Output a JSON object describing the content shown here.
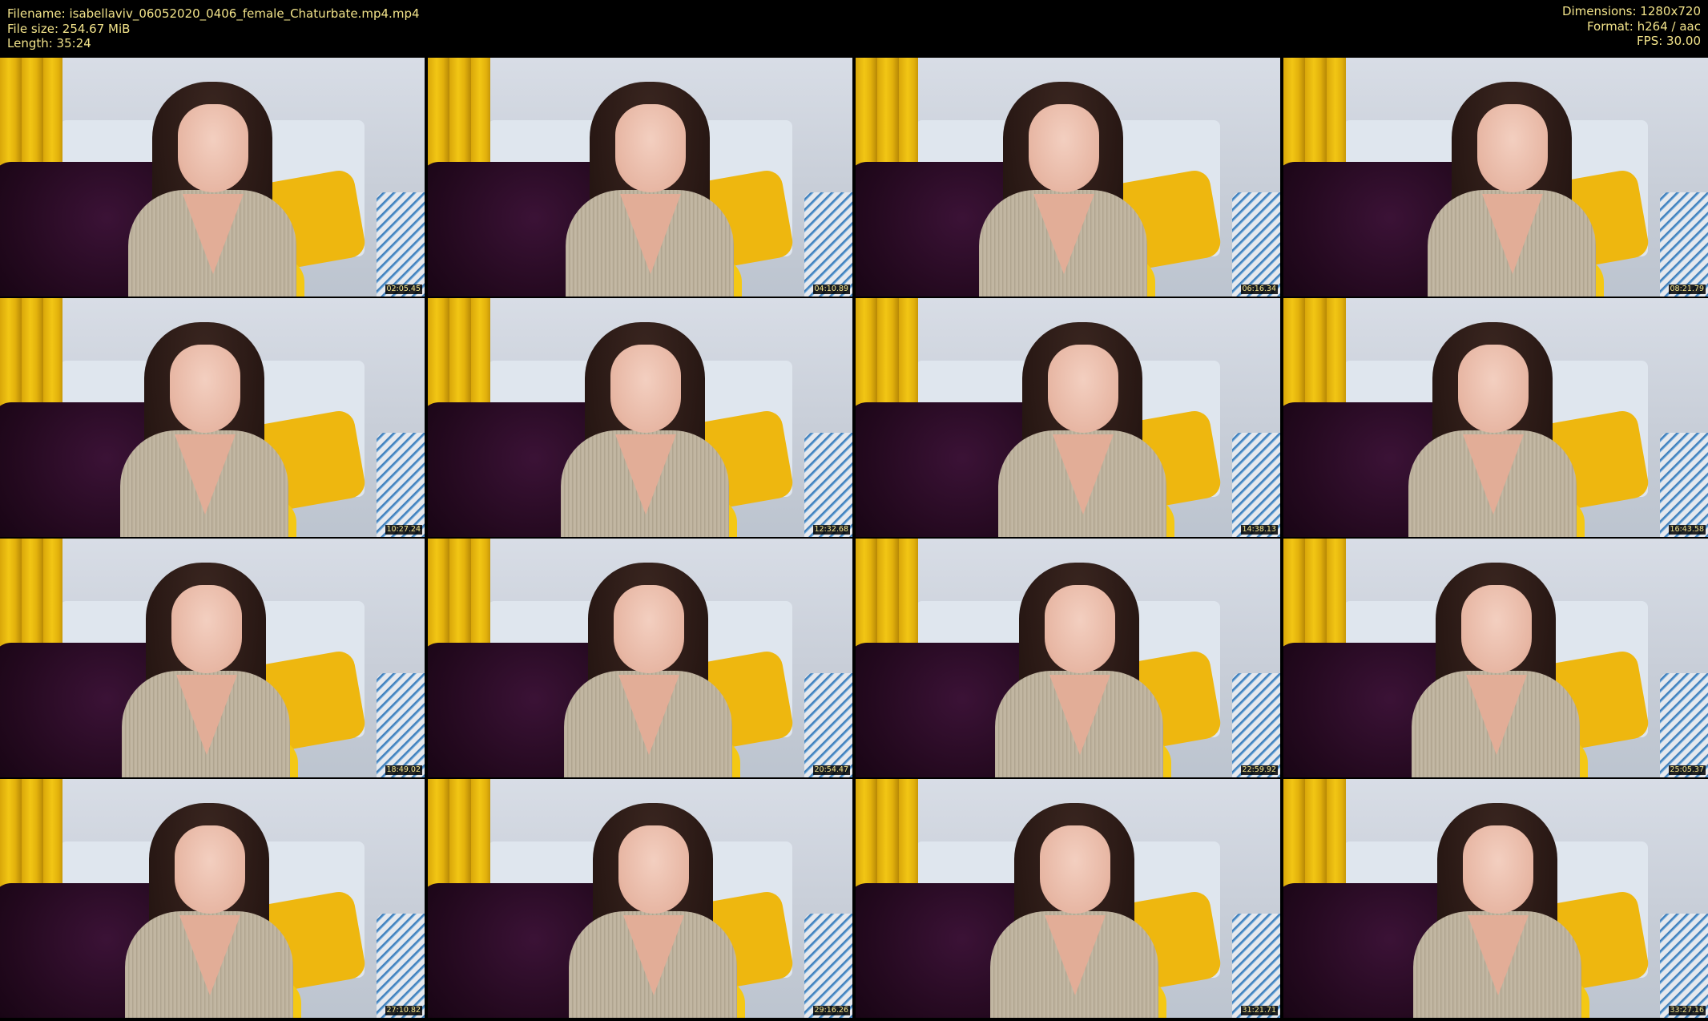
{
  "meta": {
    "filename": "Filename: isabellaviv_06052020_0406_female_Chaturbate.mp4.mp4",
    "file_size": "File size: 254.67 MiB",
    "length": "Length: 35:24",
    "dimensions": "Dimensions: 1280x720",
    "format": "Format: h264 / aac",
    "fps": "FPS: 30.00"
  },
  "colors": {
    "background": "#000000",
    "text": "#f2e38a"
  },
  "thumbnails": [
    {
      "timestamp": "02:05.45"
    },
    {
      "timestamp": "04:10.89"
    },
    {
      "timestamp": "06:16.34"
    },
    {
      "timestamp": "08:21.79"
    },
    {
      "timestamp": "10:27.24"
    },
    {
      "timestamp": "12:32.68"
    },
    {
      "timestamp": "14:38.13"
    },
    {
      "timestamp": "16:43.58"
    },
    {
      "timestamp": "18:49.02"
    },
    {
      "timestamp": "20:54.47"
    },
    {
      "timestamp": "22:59.92"
    },
    {
      "timestamp": "25:05.37"
    },
    {
      "timestamp": "27:10.82"
    },
    {
      "timestamp": "29:16.26"
    },
    {
      "timestamp": "31:21.71"
    },
    {
      "timestamp": "33:27.16"
    }
  ]
}
